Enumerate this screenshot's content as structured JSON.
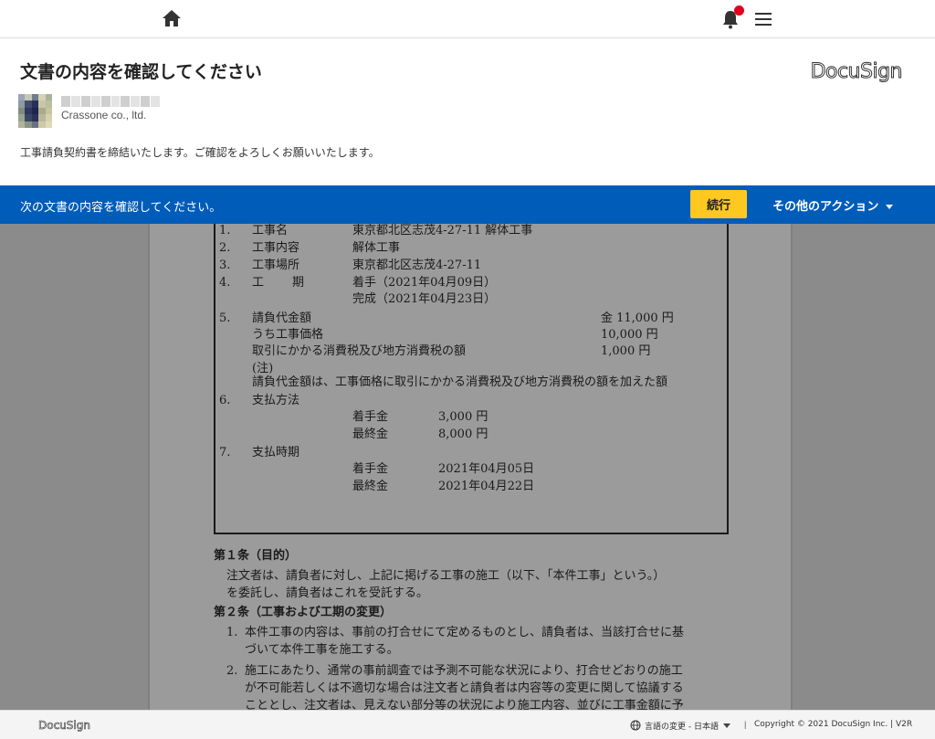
{
  "nav": {
    "home_icon": "home-icon",
    "bell_icon": "bell-icon",
    "menu_icon": "hamburger-menu-icon",
    "notification_dot_color": "#e0001b"
  },
  "header": {
    "title": "文書の内容を確認してください",
    "brand": "DocuSign",
    "sender_company": "Crassone co., ltd.",
    "message": "工事請負契約書を締結いたします。ご確認をよろしくお願いいたします。"
  },
  "action_bar": {
    "text": "次の文書の内容を確認してください。",
    "continue_label": "続行",
    "other_actions_label": "その他のアクション",
    "bar_color": "#005cb9",
    "button_color": "#ffc820"
  },
  "document": {
    "items": {
      "n1": "1.",
      "l1": "工事名",
      "v1": "東京都北区志茂4-27-11 解体工事",
      "n2": "2.",
      "l2": "工事内容",
      "v2": "解体工事",
      "n3": "3.",
      "l3": "工事場所",
      "v3": "東京都北区志茂4-27-11",
      "n4": "4.",
      "l4a": "工",
      "l4b": "期",
      "v4a": "着手（2021年04月09日）",
      "v4b": "完成（2021年04月23日）",
      "n5": "5.",
      "l5": "請負代金額",
      "v5": "金 11,000 円",
      "l5b": "うち工事価格",
      "v5b": "10,000 円",
      "l5c": "取引にかかる消費税及び地方消費税の額",
      "v5c": "1,000 円",
      "note_head": "(注)",
      "note": "請負代金額は、工事価格に取引にかかる消費税及び地方消費税の額を加えた額",
      "n6": "6.",
      "l6": "支払方法",
      "p6a_label": "着手金",
      "p6a_value": "3,000 円",
      "p6b_label": "最終金",
      "p6b_value": "8,000 円",
      "n7": "7.",
      "l7": "支払時期",
      "p7a_label": "着手金",
      "p7a_value": "2021年04月05日",
      "p7b_label": "最終金",
      "p7b_value": "2021年04月22日"
    },
    "art1_title": "第１条（目的）",
    "art1_line1": "注文者は、請負者に対し、上記に掲げる工事の施工（以下、「本件工事」という。）",
    "art1_line2": "を委託し、請負者はこれを受託する。",
    "art2_title": "第２条（工事および工期の変更）",
    "art2_1_num": "1.",
    "art2_1_line1": "本件工事の内容は、事前の打合せにて定めるものとし、請負者は、当該打合せに基",
    "art2_1_line2": "づいて本件工事を施工する。",
    "art2_2_num": "2.",
    "art2_2_line1": "施工にあたり、通常の事前調査では予測不可能な状況により、打合せどおりの施工",
    "art2_2_line2": "が不可能若しくは不適切な場合は注文者と請負者は内容等の変更に関して協議する",
    "art2_2_line3": "こととし、注文者は、見えない部分等の状況により施工内容、並びに工事金額に予"
  },
  "footer": {
    "logo": "DocuSign",
    "language_link": "言語の変更 - 日本語",
    "separator": "|",
    "copyright": "Copyright © 2021 DocuSign Inc. | V2R"
  }
}
